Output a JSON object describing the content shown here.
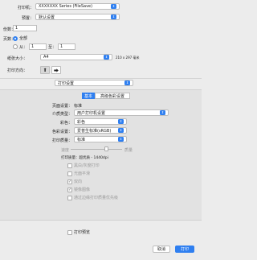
{
  "printer": {
    "label": "打印机：",
    "value": "XXXXXXX Series (FileSave)"
  },
  "preset": {
    "label": "预置：",
    "value": "默认设置"
  },
  "copies": {
    "label": "份数：",
    "value": "1"
  },
  "pages": {
    "label": "页数：",
    "all_label": "全部",
    "from_label": "从：",
    "from_value": "1",
    "to_label": "至：",
    "to_value": "1"
  },
  "paper_size": {
    "label": "纸张大小：",
    "value": "A4",
    "dimensions": "210 x 297 毫米"
  },
  "orientation": {
    "label": "打印方向："
  },
  "section_popup": {
    "value": "打印设置"
  },
  "tabs": [
    {
      "label": "基本"
    },
    {
      "label": "高级色彩设置"
    }
  ],
  "settings": {
    "page_setup": {
      "label": "页面设置：",
      "value": "标准"
    },
    "media_type": {
      "label": "介质类型：",
      "value": "用户打印机设置"
    },
    "color": {
      "label": "彩色：",
      "value": "彩色"
    },
    "color_mode": {
      "label": "色彩设置：",
      "value": "爱普生标准(sRGB)"
    },
    "print_quality": {
      "label": "打印质量：",
      "value": "标准"
    },
    "slider_left": "速度",
    "slider_right": "质量",
    "quality_info": "打印质量：超优质 - 1440dpi"
  },
  "options": [
    {
      "label": "黑白/灰度打印",
      "checked": false
    },
    {
      "label": "光面平滑",
      "checked": false
    },
    {
      "label": "双向",
      "checked": true
    },
    {
      "label": "镜像图像",
      "checked": true
    },
    {
      "label": "通过边缘打印质量优先级",
      "checked": false
    }
  ],
  "print_preview": {
    "label": "打印预览"
  },
  "buttons": {
    "cancel": "取消",
    "print": "打印"
  }
}
